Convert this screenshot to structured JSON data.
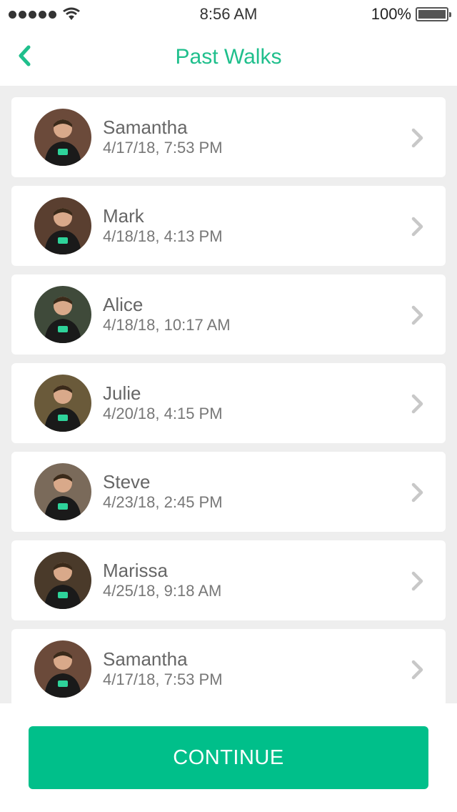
{
  "status_bar": {
    "time": "8:56 AM",
    "battery_text": "100%",
    "icons": [
      "signal-dots-icon",
      "wifi-icon",
      "battery-icon"
    ]
  },
  "nav": {
    "title": "Past Walks",
    "back_icon": "chevron-left-icon",
    "accent_color": "#1fbf8c"
  },
  "walks": [
    {
      "name": "Samantha",
      "date": "4/17/18, 7:53 PM",
      "avatar_bg": "#6b4a3a"
    },
    {
      "name": "Mark",
      "date": "4/18/18, 4:13 PM",
      "avatar_bg": "#5a3f30"
    },
    {
      "name": "Alice",
      "date": "4/18/18, 10:17 AM",
      "avatar_bg": "#3f4a3a"
    },
    {
      "name": "Julie",
      "date": "4/20/18, 4:15 PM",
      "avatar_bg": "#6a5a3a"
    },
    {
      "name": "Steve",
      "date": "4/23/18, 2:45 PM",
      "avatar_bg": "#7a6a5a"
    },
    {
      "name": "Marissa",
      "date": "4/25/18, 9:18 AM",
      "avatar_bg": "#4a3a2a"
    },
    {
      "name": "Samantha",
      "date": "4/17/18, 7:53 PM",
      "avatar_bg": "#6b4a3a"
    }
  ],
  "footer": {
    "continue_label": "CONTINUE",
    "button_color": "#00bf8a"
  }
}
